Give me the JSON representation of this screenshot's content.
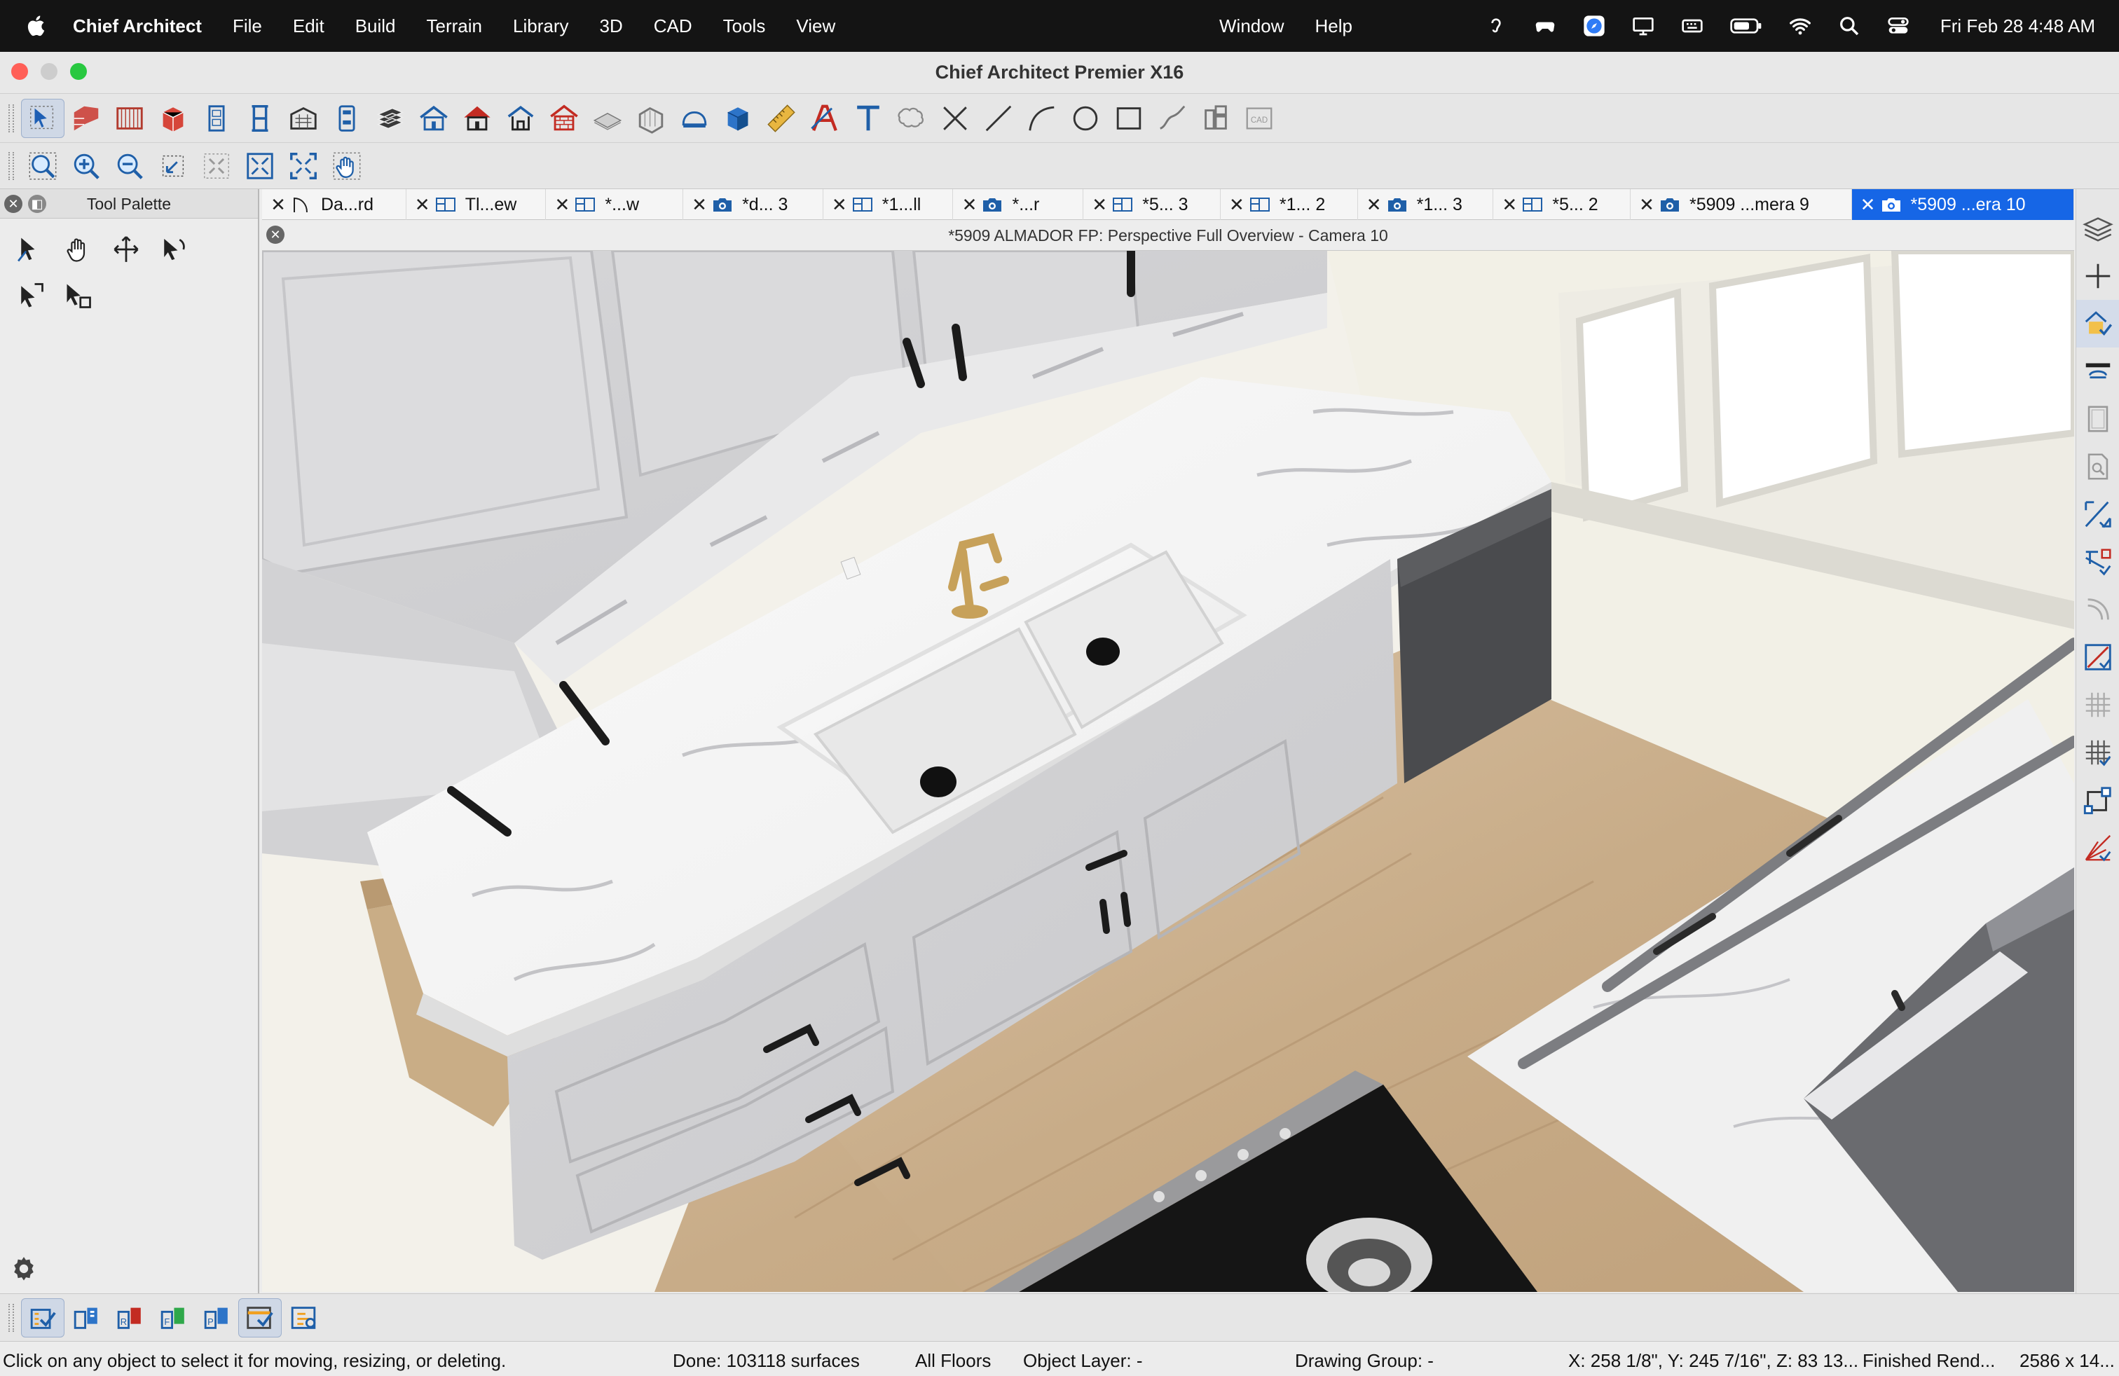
{
  "menubar": {
    "app_name": "Chief Architect",
    "items": [
      "File",
      "Edit",
      "Build",
      "Terrain",
      "Library",
      "3D",
      "CAD",
      "Tools",
      "View"
    ],
    "right_items": [
      "Window",
      "Help"
    ],
    "status_icons": [
      "hearing-icon",
      "gamepad-icon",
      "safari-icon",
      "display-icon",
      "keyboard-brightness-icon",
      "battery-icon",
      "wifi-icon",
      "spotlight-search-icon",
      "control-center-icon"
    ],
    "clock": "Fri Feb 28  4:48 AM"
  },
  "window": {
    "title": "Chief Architect Premier X16"
  },
  "toolbar1": {
    "tools": [
      "select-objects",
      "walls",
      "cabinets",
      "cabinet-library",
      "doors",
      "windows",
      "stairs",
      "fixtures",
      "electrical",
      "roof",
      "framing",
      "dormer",
      "floor-plan",
      "terrain",
      "slab",
      "materials",
      "3d-box",
      "dimension",
      "text-style",
      "text",
      "callout",
      "delete",
      "line",
      "arc",
      "circle",
      "rectangle",
      "spline",
      "wall-elevation",
      "cad-block"
    ]
  },
  "toolbar2": {
    "tools": [
      "zoom-window",
      "zoom-in",
      "zoom-out",
      "undo-zoom",
      "fill-window",
      "fill-window-building",
      "fill-window-all",
      "pan"
    ]
  },
  "palette": {
    "title": "Tool Palette",
    "tools": [
      "select-edge",
      "pan-hand",
      "move",
      "rotate-select",
      "select-group",
      "select-layer"
    ]
  },
  "tabs": [
    {
      "label": "Da...rd",
      "icon": "arc-icon"
    },
    {
      "label": "Tl...ew",
      "icon": "floorplan-icon"
    },
    {
      "label": "*...w",
      "icon": "floorplan-icon"
    },
    {
      "label": "*d... 3",
      "icon": "camera-icon"
    },
    {
      "label": "*1...ll",
      "icon": "floorplan-icon"
    },
    {
      "label": "*...r",
      "icon": "camera-icon"
    },
    {
      "label": "*5... 3",
      "icon": "floorplan-icon"
    },
    {
      "label": "*1... 2",
      "icon": "floorplan-icon"
    },
    {
      "label": "*1... 3",
      "icon": "camera-icon"
    },
    {
      "label": "*5... 2",
      "icon": "floorplan-icon"
    },
    {
      "label": "*5909 ...mera 9",
      "icon": "camera-icon"
    },
    {
      "label": "*5909 ...era 10",
      "icon": "camera-icon",
      "active": true
    }
  ],
  "view": {
    "title": "*5909 ALMADOR FP: Perspective Full Overview - Camera 10"
  },
  "righttools": [
    "layer-display",
    "add-guide",
    "layer-set-active",
    "reference-display",
    "wall-plane",
    "zoom-page",
    "edit-area",
    "edit-section",
    "curve-tool",
    "plane-tool",
    "grid-display",
    "snap-grid",
    "object-snap",
    "angle-snap"
  ],
  "bottomtools": [
    "living-area-checklist",
    "floor-view",
    "room-view",
    "framing-view",
    "plan-view",
    "sheet-layout",
    "plot-plan"
  ],
  "status": {
    "hint": "Click on any object to select it for moving, resizing, or deleting.",
    "done": "Done:  103118 surfaces",
    "floors": "All Floors",
    "object_layer": "Object Layer: -",
    "drawing_group": "Drawing Group: -",
    "coords": "X: 258 1/8\", Y: 245 7/16\", Z: 83 13...",
    "render": "Finished Rend...",
    "size": "2586 x 14..."
  },
  "colors": {
    "menubar": "#141414",
    "active_tab": "#1666e6",
    "close_light": "#ff5f57",
    "min_light": "#c8c8c8",
    "max_light": "#28c840"
  }
}
